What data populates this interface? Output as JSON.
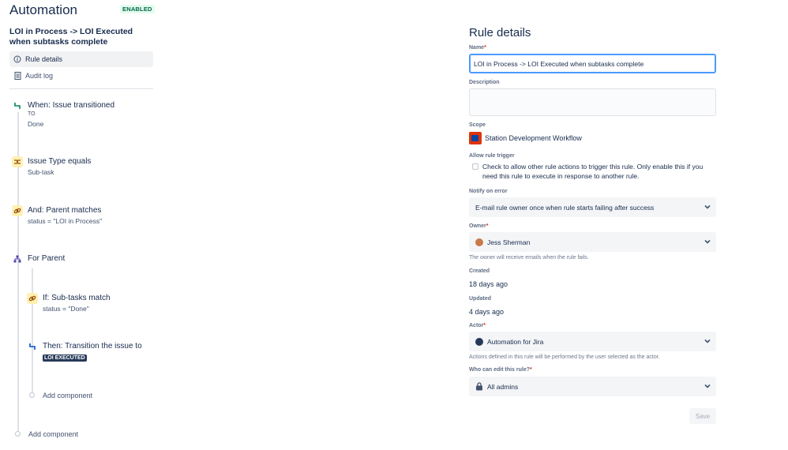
{
  "app": {
    "title": "Automation",
    "badge": "ENABLED"
  },
  "rule": {
    "name": "LOI in Process -> LOI Executed when subtasks complete"
  },
  "nav": [
    {
      "label": "Rule details",
      "icon": "info-icon",
      "active": true
    },
    {
      "label": "Audit log",
      "icon": "document-icon",
      "active": false
    }
  ],
  "flow": {
    "trigger": {
      "title": "When: Issue transitioned",
      "to_label": "TO",
      "to_value": "Done"
    },
    "condition1": {
      "title": "Issue Type equals",
      "sub": "Sub-task"
    },
    "condition2": {
      "title": "And: Parent matches",
      "sub": "status = \"LOI in Process\""
    },
    "branch": {
      "title": "For Parent"
    },
    "branch_condition": {
      "title": "If: Sub-tasks match",
      "sub": "status = \"Done\""
    },
    "branch_action": {
      "title": "Then: Transition the issue to",
      "lozenge": "LOI EXECUTED"
    },
    "add_inner": "Add component",
    "add_outer": "Add component"
  },
  "details": {
    "heading": "Rule details",
    "name_label": "Name",
    "name_value": "LOI in Process -> LOI Executed when subtasks complete",
    "description_label": "Description",
    "scope_label": "Scope",
    "scope_value": "Station Development Workflow",
    "allow_trigger_label": "Allow rule trigger",
    "allow_trigger_text": "Check to allow other rule actions to trigger this rule. Only enable this if you need this rule to execute in response to another rule.",
    "notify_label": "Notify on error",
    "notify_value": "E-mail rule owner once when rule starts failing after success",
    "owner_label": "Owner",
    "owner_value": "Jess Sherman",
    "owner_help": "The owner will receive emails when the rule fails.",
    "created_label": "Created",
    "created_value": "18 days ago",
    "updated_label": "Updated",
    "updated_value": "4 days ago",
    "actor_label": "Actor",
    "actor_value": "Automation for Jira",
    "actor_help": "Actions defined in this rule will be performed by the user selected as the actor.",
    "edit_label": "Who can edit this rule?",
    "edit_value": "All admins",
    "save_label": "Save",
    "required_mark": "*"
  },
  "colors": {
    "accent": "#4c9aff",
    "enabled": "#006644",
    "required": "#de350b"
  }
}
